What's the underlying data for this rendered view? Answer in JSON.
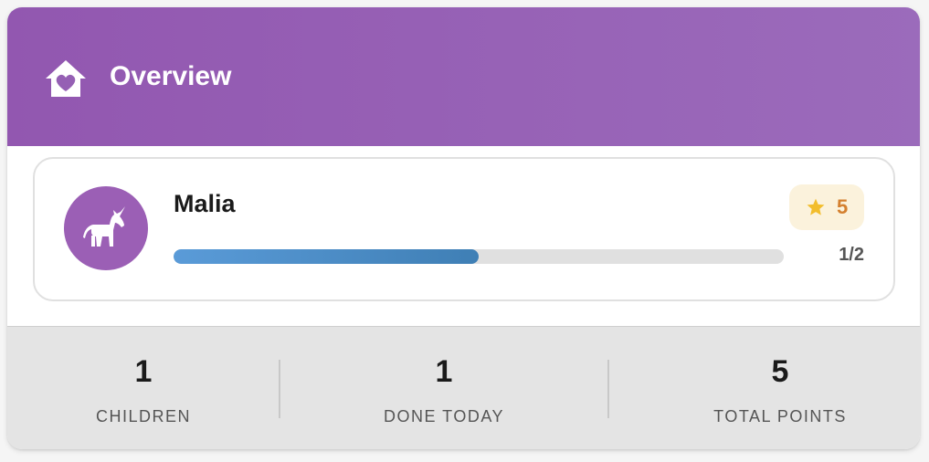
{
  "header": {
    "title": "Overview",
    "icon": "home-heart-icon",
    "color": "#9257b0"
  },
  "children": [
    {
      "name": "Malia",
      "avatar_icon": "unicorn-icon",
      "avatar_color": "#9b5fb5",
      "points": "5",
      "points_icon": "star-icon",
      "progress_text": "1/2",
      "progress_fraction": 0.5
    }
  ],
  "stats": [
    {
      "value": "1",
      "label": "CHILDREN"
    },
    {
      "value": "1",
      "label": "DONE TODAY"
    },
    {
      "value": "5",
      "label": "TOTAL POINTS"
    }
  ]
}
